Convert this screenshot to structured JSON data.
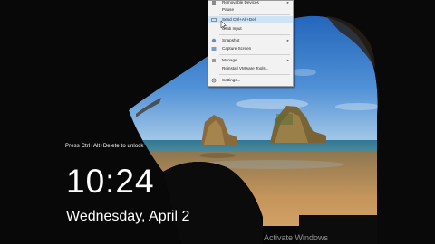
{
  "lock_screen": {
    "unlock_hint": "Press Ctrl+Alt+Delete to unlock",
    "time": "10:24",
    "date": "Wednesday, April 2"
  },
  "watermark": "Activate Windows",
  "context_menu": {
    "items": [
      {
        "label": "Removable Devices",
        "icon": "usb-icon",
        "has_submenu": true,
        "highlighted": false
      },
      {
        "label": "Pause",
        "icon": "pause-icon",
        "has_submenu": false,
        "highlighted": false
      },
      {
        "label": "Send Ctrl+Alt+Del",
        "icon": "keyboard-icon",
        "has_submenu": false,
        "highlighted": true
      },
      {
        "label": "Grab Input",
        "icon": "grab-icon",
        "has_submenu": false,
        "highlighted": false
      },
      {
        "label": "Snapshot",
        "icon": "snapshot-icon",
        "has_submenu": true,
        "highlighted": false
      },
      {
        "label": "Capture Screen",
        "icon": "capture-icon",
        "has_submenu": false,
        "highlighted": false
      },
      {
        "label": "Manage",
        "icon": "manage-icon",
        "has_submenu": true,
        "highlighted": false
      },
      {
        "label": "Reinstall VMware Tools...",
        "icon": "tools-icon",
        "has_submenu": false,
        "highlighted": false
      },
      {
        "label": "Settings...",
        "icon": "settings-icon",
        "has_submenu": false,
        "highlighted": false
      }
    ]
  },
  "colors": {
    "sky_top": "#1f63b8",
    "sky_bottom": "#7ab3e0",
    "sea": "#2c6f8a",
    "sand": "#c99a60",
    "cave": "#0a0a0a",
    "menu_highlight": "#cfe3f7"
  }
}
